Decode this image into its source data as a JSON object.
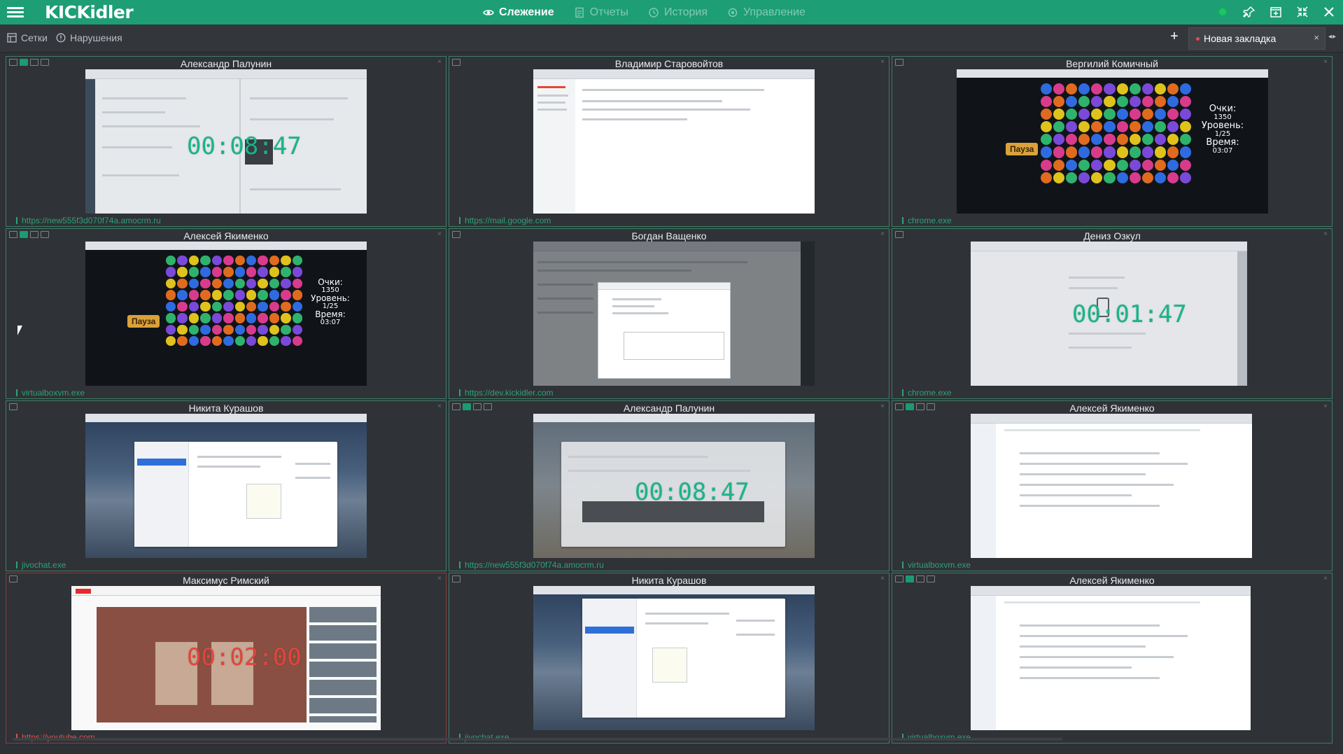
{
  "app": {
    "logo": "KICKidler"
  },
  "nav": [
    {
      "label": "Слежение",
      "icon": "eye-icon",
      "active": true
    },
    {
      "label": "Отчеты",
      "icon": "report-icon",
      "active": false
    },
    {
      "label": "История",
      "icon": "history-icon",
      "active": false
    },
    {
      "label": "Управление",
      "icon": "manage-icon",
      "active": false
    }
  ],
  "subbar": {
    "grids_label": "Сетки",
    "violations_label": "Нарушения",
    "add_tab": "+",
    "tab_label": "Новая закладка",
    "tab_close": "×",
    "arrows": "◂▸"
  },
  "colors": {
    "accent": "#1d9e74",
    "alert": "#e05050",
    "timer": "#18b48a"
  },
  "cells": [
    {
      "name": "Александр Палунин",
      "foot": "https://new555f3d070f74a.amocrm.ru",
      "timer": "00:08:47",
      "icons_active": true
    },
    {
      "name": "Владимир Старовойтов",
      "foot": "https://mail.google.com",
      "timer": "",
      "icons_active": false
    },
    {
      "name": "Вергилий Комичный",
      "foot": "chrome.exe",
      "timer": "",
      "icons_active": false
    },
    {
      "name": "Алексей Якименко",
      "foot": "virtualboxvm.exe",
      "timer": "",
      "icons_active": true
    },
    {
      "name": "Богдан Ващенко",
      "foot": "https://dev.kickidler.com",
      "timer": "",
      "icons_active": false
    },
    {
      "name": "Дениз Озкул",
      "foot": "chrome.exe",
      "timer": "00:01:47",
      "icons_active": false
    },
    {
      "name": "Никита Курашов",
      "foot": "jivochat.exe",
      "timer": "",
      "icons_active": false
    },
    {
      "name": "Александр Палунин",
      "foot": "https://new555f3d070f74a.amocrm.ru",
      "timer": "00:08:47",
      "icons_active": true
    },
    {
      "name": "Алексей Якименко",
      "foot": "virtualboxvm.exe",
      "timer": "",
      "icons_active": true
    },
    {
      "name": "Максимус Римский",
      "foot": "https://youtube.com",
      "timer": "00:02:00",
      "icons_active": false
    },
    {
      "name": "Никита Курашов",
      "foot": "jivochat.exe",
      "timer": "",
      "icons_active": false
    },
    {
      "name": "Алексей Якименко",
      "foot": "virtualboxvm.exe",
      "timer": "",
      "icons_active": true
    }
  ],
  "game": {
    "score_label": "Очки:",
    "score": "1350",
    "level_label": "Уровень:",
    "level": "1/25",
    "time_label": "Время:",
    "time": "03:07",
    "pause": "Пауза"
  }
}
